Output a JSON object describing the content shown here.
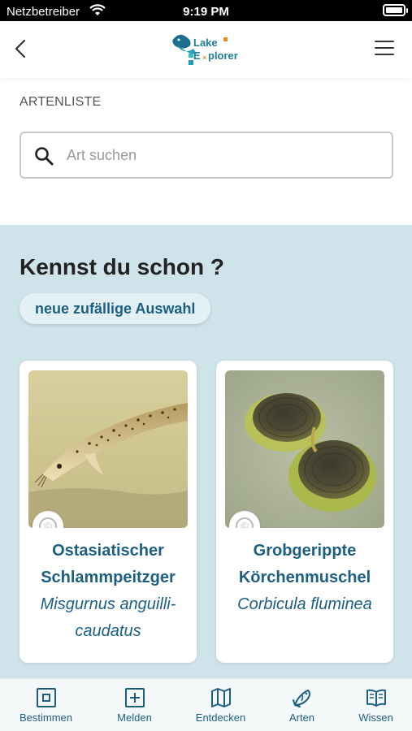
{
  "status_bar": {
    "carrier": "Netzbetreiber",
    "time": "9:19 PM"
  },
  "header": {
    "logo_line1": "Lake",
    "logo_line2": "E",
    "logo_line2_rest": "plorer",
    "back_icon": "chevron-left-icon",
    "menu_icon": "hamburger-menu-icon"
  },
  "species_list": {
    "section_label": "ARTENLISTE",
    "search_placeholder": "Art suchen",
    "search_value": ""
  },
  "discover": {
    "title": "Kennst du schon ?",
    "random_button": "neue zufällige Auswahl",
    "cards": [
      {
        "name_line1": "Ostasiatischer",
        "name_line2": "Schlammpeitzger",
        "latin_line1": "Misgurnus anguilli-",
        "latin_line2": "caudatus",
        "copyright_symbol": "©"
      },
      {
        "name_line1": "Grobgerippte",
        "name_line2": "Körchenmuschel",
        "latin_line1": "Corbicula fluminea",
        "latin_line2": "",
        "copyright_symbol": "©"
      }
    ]
  },
  "tab_bar": {
    "tabs": [
      {
        "label": "Bestimmen",
        "icon": "identify-icon"
      },
      {
        "label": "Melden",
        "icon": "report-plus-icon"
      },
      {
        "label": "Entdecken",
        "icon": "map-icon"
      },
      {
        "label": "Arten",
        "icon": "fish-icon"
      },
      {
        "label": "Wissen",
        "icon": "book-icon"
      }
    ]
  },
  "colors": {
    "accent": "#1c5f83",
    "logo": "#1f7f9a",
    "discover_bg": "#cfe3ea",
    "tab_bg": "#f4f8f9"
  }
}
